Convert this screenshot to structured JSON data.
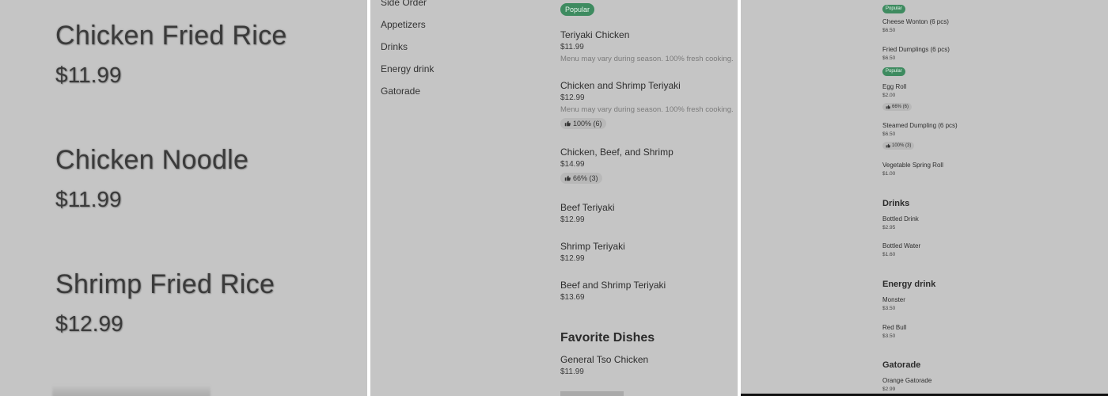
{
  "panel1": {
    "items": [
      {
        "name": "Chicken Fried Rice",
        "price": "$11.99"
      },
      {
        "name": "Chicken Noodle",
        "price": "$11.99"
      },
      {
        "name": "Shrimp Fried Rice",
        "price": "$12.99"
      }
    ]
  },
  "panel2": {
    "categories": [
      "Side Order",
      "Appetizers",
      "Drinks",
      "Energy drink",
      "Gatorade"
    ],
    "popular_badge": "Popular",
    "items": [
      {
        "name": "Teriyaki Chicken",
        "price": "$11.99",
        "desc": "Menu may vary during season. 100% fresh cooking."
      },
      {
        "name": "Chicken and Shrimp Teriyaki",
        "price": "$12.99",
        "desc": "Menu may vary during season. 100% fresh cooking.",
        "rating": "100% (6)"
      },
      {
        "name": "Chicken, Beef, and Shrimp",
        "price": "$14.99",
        "rating": "66% (3)"
      },
      {
        "name": "Beef Teriyaki",
        "price": "$12.99"
      },
      {
        "name": "Shrimp Teriyaki",
        "price": "$12.99"
      },
      {
        "name": "Beef and Shrimp Teriyaki",
        "price": "$13.69"
      }
    ],
    "section_title": "Favorite Dishes",
    "favorite_items": [
      {
        "name": "General Tso Chicken",
        "price": "$11.99"
      }
    ]
  },
  "panel3": {
    "top_badge": "Popular",
    "items": [
      {
        "name": "Cheese Wonton (6 pcs)",
        "price": "$6.50"
      },
      {
        "name": "Fried Dumplings (6 pcs)",
        "price": "$6.50",
        "badge": "Popular"
      },
      {
        "name": "Egg Roll",
        "price": "$2.00",
        "rating": "66% (6)"
      },
      {
        "name": "Steamed Dumpling (6 pcs)",
        "price": "$6.50",
        "rating": "100% (3)"
      },
      {
        "name": "Vegetable Spring Roll",
        "price": "$1.00"
      }
    ],
    "drinks_title": "Drinks",
    "drinks": [
      {
        "name": "Bottled Drink",
        "price": "$2.95"
      },
      {
        "name": "Bottled Water",
        "price": "$1.60"
      }
    ],
    "energy_title": "Energy drink",
    "energy": [
      {
        "name": "Monster",
        "price": "$3.50"
      },
      {
        "name": "Red Bull",
        "price": "$3.50"
      }
    ],
    "gatorade_title": "Gatorade",
    "gatorade": [
      {
        "name": "Orange Gatorade",
        "price": "$2.99"
      }
    ]
  },
  "colors": {
    "panel_bg": "#c5c5c5",
    "badge_green": "#3e8b60"
  }
}
